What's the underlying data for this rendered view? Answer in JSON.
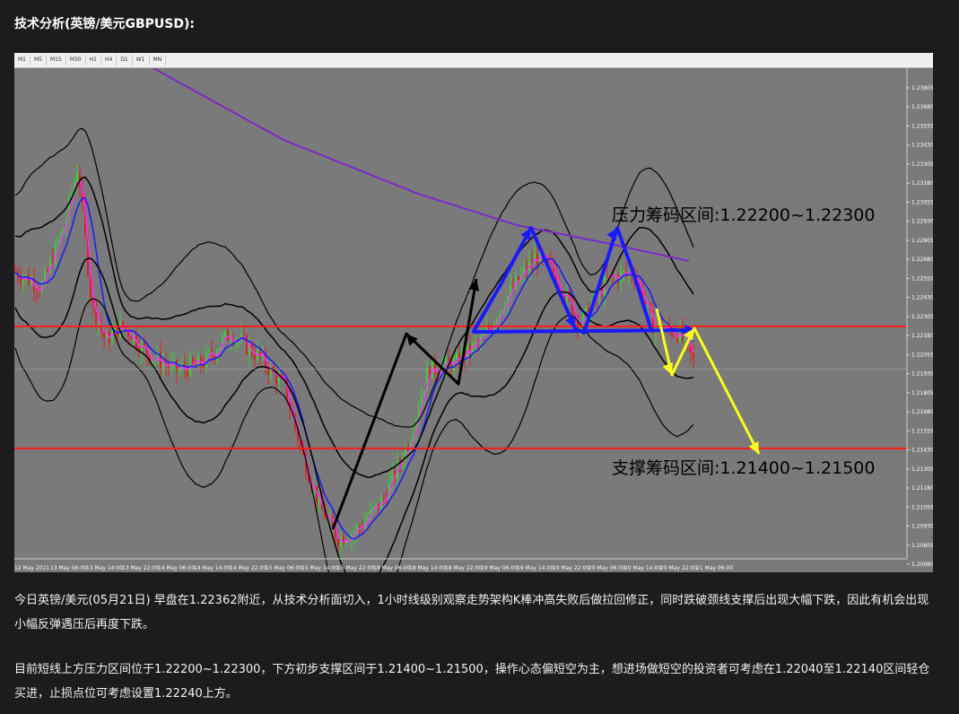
{
  "heading": "技术分析(英镑/美元GBPUSD):",
  "toolbar": {
    "timeframes": [
      "M1",
      "M5",
      "M15",
      "M30",
      "H1",
      "H4",
      "D1",
      "W1",
      "MN"
    ]
  },
  "chart_data": {
    "type": "candlestick",
    "y_axis_ticks": [
      "1.23805",
      "1.23680",
      "1.23555",
      "1.23430",
      "1.23305",
      "1.23180",
      "1.23055",
      "1.22930",
      "1.22805",
      "1.22680",
      "1.22555",
      "1.22430",
      "1.22305",
      "1.22180",
      "1.22055",
      "1.21930",
      "1.21805",
      "1.21680",
      "1.21555",
      "1.21430",
      "1.21305",
      "1.21180",
      "1.21055",
      "1.20930",
      "1.20805",
      "1.20680"
    ],
    "ylim": [
      1.2064,
      1.2392
    ],
    "x_axis_ticks": [
      "12 May 2021",
      "13 May 06:00",
      "13 May 14:00",
      "13 May 22:00",
      "14 May 06:00",
      "14 May 14:00",
      "14 May 22:00",
      "15 May 06:00",
      "15 May 14:00",
      "15 May 22:00",
      "18 May 06:00",
      "18 May 14:00",
      "18 May 22:00",
      "19 May 06:00",
      "19 May 14:00",
      "19 May 22:00",
      "20 May 06:00",
      "20 May 14:00",
      "20 May 22:00",
      "21 May 06:00"
    ],
    "resistance_label": "压力筹码区间:1.22200~1.22300",
    "support_label": "支撑筹码区间:1.21400~1.21500",
    "resistance_line": 1.2224,
    "support_line": 1.2144,
    "current_price": 1.2196,
    "colors": {
      "background": "#7a7a7a",
      "bull": "#33d633",
      "bear": "#e02020",
      "bollinger": "#000000",
      "ma_purple": "#7a2ac8",
      "ma_blue": "#1a1aff",
      "ma_magenta": "#ff2aff",
      "horizontal_lines": "#ff1a1a",
      "arrow_black": "#000000",
      "arrow_blue": "#1a1aff",
      "arrow_yellow": "#ffff1a"
    }
  },
  "analysis": {
    "para1": "今日英镑/美元(05月21日) 早盘在1.22362附近，从技术分析面切入，1小时线级别观察走势架构K棒冲高失败后做拉回修正，同时跌破颈线支撑后出现大幅下跌，因此有机会出现小幅反弹遇压后再度下跌。",
    "para2": "目前短线上方压力区间位于1.22200~1.22300，下方初步支撑区间于1.21400~1.21500，操作心态偏短空为主，想进场做短空的投资者可考虑在1.22040至1.22140区间轻仓买进，止损点位可考虑设置1.22240上方。"
  }
}
